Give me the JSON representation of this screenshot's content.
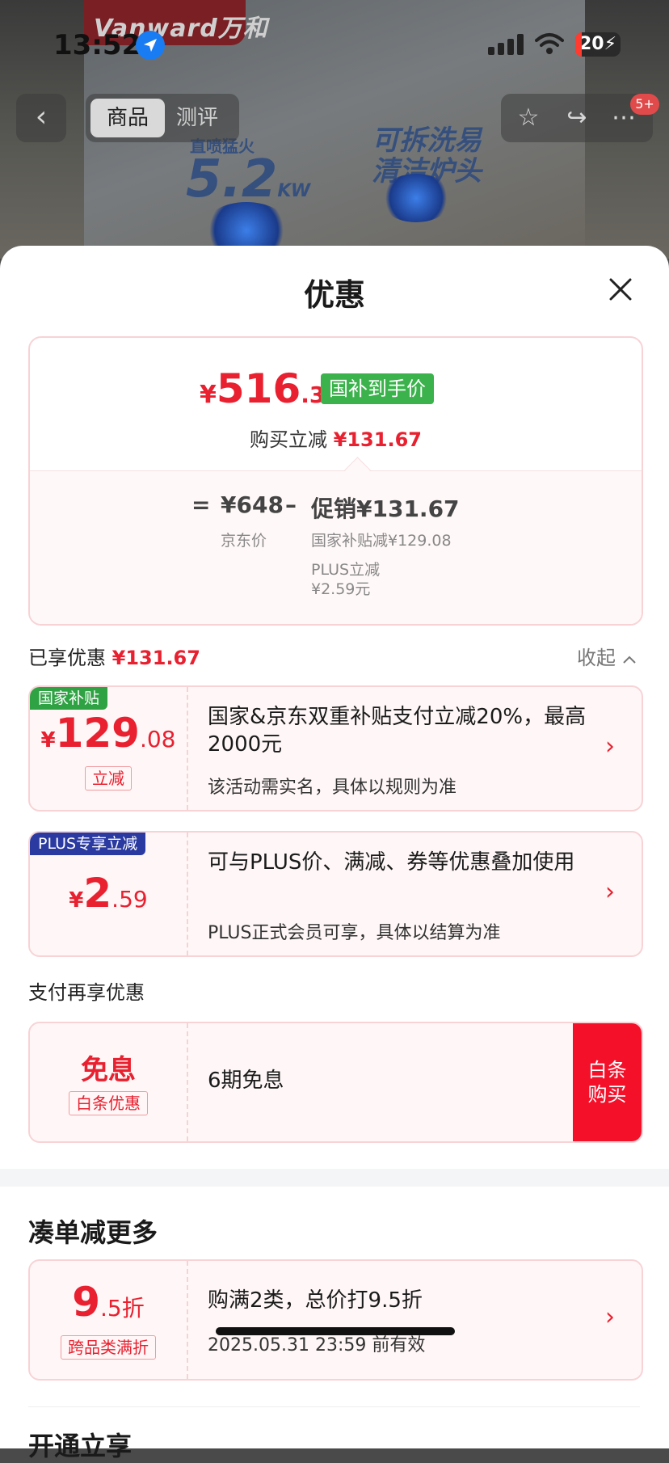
{
  "status_bar": {
    "time": "13:52",
    "battery": "20"
  },
  "background": {
    "brand": "Vanward万和",
    "promo_power": "5.2",
    "promo_power_unit": "KW",
    "promo_power_label": "直喷猛火",
    "promo_clean": "可拆洗易清洁炉头"
  },
  "nav": {
    "tabs": [
      {
        "label": "商品",
        "active": true
      },
      {
        "label": "测评",
        "active": false
      }
    ],
    "badge": "5+"
  },
  "sheet": {
    "title": "优惠",
    "price_card": {
      "final_currency": "¥",
      "final_int": "516",
      "final_dec": ".33",
      "final_tag": "国补到手价",
      "reduce_label": "购买立减",
      "reduce_amount": "¥131.67",
      "formula_eq": "=",
      "jd_price": "¥648",
      "jd_price_label": "京东价",
      "minus": "–",
      "promo_total": "促销¥131.67",
      "promo_items": [
        "国家补贴减¥129.08",
        "PLUS立减",
        "¥2.59元"
      ]
    },
    "enjoyed": {
      "label": "已享优惠",
      "amount": "¥131.67",
      "collapse": "收起"
    },
    "coupons": [
      {
        "tag": "国家补贴",
        "tag_color": "#2fa244",
        "currency": "¥",
        "int": "129",
        "dec": ".08",
        "sub": "立减",
        "title": "国家&京东双重补贴支付立减20%，最高2000元",
        "desc": "该活动需实名，具体以规则为准"
      },
      {
        "tag": "PLUS专享立减",
        "tag_color": "#2a3aa0",
        "currency": "¥",
        "int": "2",
        "dec": ".59",
        "title": "可与PLUS价、满减、券等优惠叠加使用",
        "desc": "PLUS正式会员可享，具体以结算为准"
      }
    ],
    "pay_section": {
      "label": "支付再享优惠",
      "card": {
        "big": "免息",
        "sub": "白条优惠",
        "title": "6期免息",
        "button": "白条购买"
      }
    },
    "combine_section": {
      "title": "凑单减更多",
      "card": {
        "int": "9",
        "dec": ".5折",
        "sub": "跨品类满折",
        "title": "购满2类，总价打9.5折",
        "desc": "2025.05.31 23:59 前有效"
      }
    },
    "next_section_title": "开通立享"
  },
  "colors": {
    "accent_red": "#e8202f",
    "green_tag": "#3bb24b",
    "baitiao_red": "#f5102a"
  }
}
